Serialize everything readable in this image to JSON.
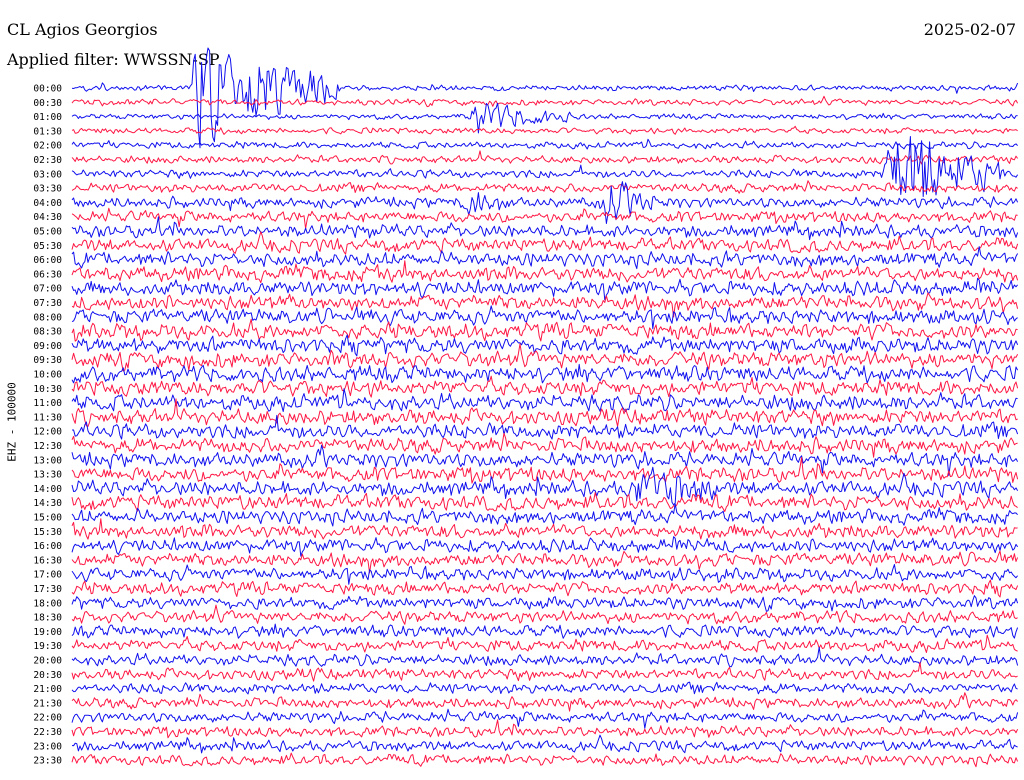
{
  "header": {
    "station": "CL Agios Georgios",
    "filter": "Applied filter: WWSSN-SP",
    "date": "2025-02-07"
  },
  "axis": {
    "channel_label": "EHZ - 100000"
  },
  "colors": {
    "trace_a": "#1010ee",
    "trace_b": "#ff1744",
    "background": "#ffffff"
  },
  "chart_data": {
    "type": "line",
    "chart_kind": "helicorder",
    "ylabel": "EHZ - 100000",
    "row_labels": [
      "00:00",
      "00:30",
      "01:00",
      "01:30",
      "02:00",
      "02:30",
      "03:00",
      "03:30",
      "04:00",
      "04:30",
      "05:00",
      "05:30",
      "06:00",
      "06:30",
      "07:00",
      "07:30",
      "08:00",
      "08:30",
      "09:00",
      "09:30",
      "10:00",
      "10:30",
      "11:00",
      "11:30",
      "12:00",
      "12:30",
      "13:00",
      "13:30",
      "14:00",
      "14:30",
      "15:00",
      "15:30",
      "16:00",
      "16:30",
      "17:00",
      "17:30",
      "18:00",
      "18:30",
      "19:00",
      "19:30",
      "20:00",
      "20:30",
      "21:00",
      "21:30",
      "22:00",
      "22:30",
      "23:00",
      "23:30"
    ],
    "row_duration_minutes": 30,
    "series_colors_alternate": [
      "blue",
      "red"
    ],
    "noise_amplitude_by_row": [
      0.35,
      0.4,
      0.35,
      0.4,
      0.45,
      0.5,
      0.55,
      0.6,
      0.7,
      0.75,
      0.85,
      0.9,
      0.95,
      1.0,
      1.0,
      1.0,
      1.0,
      1.05,
      1.05,
      1.05,
      1.05,
      1.05,
      1.05,
      1.05,
      1.0,
      1.0,
      1.0,
      1.0,
      1.0,
      1.0,
      0.95,
      0.95,
      0.9,
      0.9,
      0.85,
      0.85,
      0.8,
      0.8,
      0.8,
      0.8,
      0.75,
      0.75,
      0.7,
      0.7,
      0.7,
      0.7,
      0.7,
      0.7
    ],
    "events": [
      {
        "row": 0,
        "minute": 4.0,
        "amplitude": 9.0,
        "duration_minutes": 4.5
      },
      {
        "row": 6,
        "minute": 26.0,
        "amplitude": 8.0,
        "duration_minutes": 3.5
      },
      {
        "row": 2,
        "minute": 12.8,
        "amplitude": 2.5,
        "duration_minutes": 3.0
      },
      {
        "row": 8,
        "minute": 17.0,
        "amplitude": 3.0,
        "duration_minutes": 1.5
      },
      {
        "row": 8,
        "minute": 12.6,
        "amplitude": 2.0,
        "duration_minutes": 1.2
      },
      {
        "row": 28,
        "minute": 18.0,
        "amplitude": 3.0,
        "duration_minutes": 2.5
      }
    ]
  }
}
